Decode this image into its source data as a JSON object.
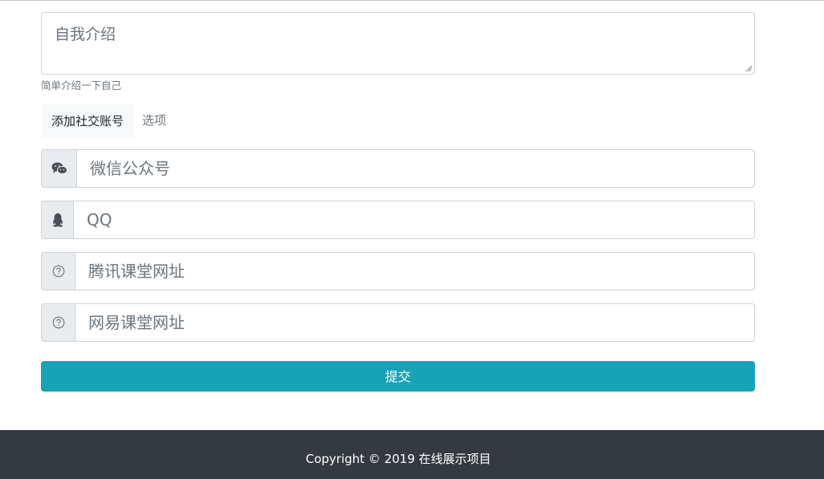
{
  "bio": {
    "placeholder": "自我介绍",
    "value": "",
    "help_text": "简单介绍一下自己"
  },
  "social": {
    "label": "添加社交账号",
    "suffix": "选项",
    "fields": [
      {
        "icon": "wechat-icon",
        "placeholder": "微信公众号",
        "value": ""
      },
      {
        "icon": "qq-penguin-icon",
        "placeholder": "QQ",
        "value": ""
      },
      {
        "icon": "question-circle-icon",
        "placeholder": "腾讯课堂网址",
        "value": ""
      },
      {
        "icon": "question-circle-icon",
        "placeholder": "网易课堂网址",
        "value": ""
      }
    ]
  },
  "submit_label": "提交",
  "footer": {
    "copyright": "Copyright © 2019 在线展示项目"
  },
  "colors": {
    "primary": "#17a2b8",
    "footer_bg": "#343a40",
    "addon_bg": "#e9ecef",
    "border": "#ced4da"
  }
}
